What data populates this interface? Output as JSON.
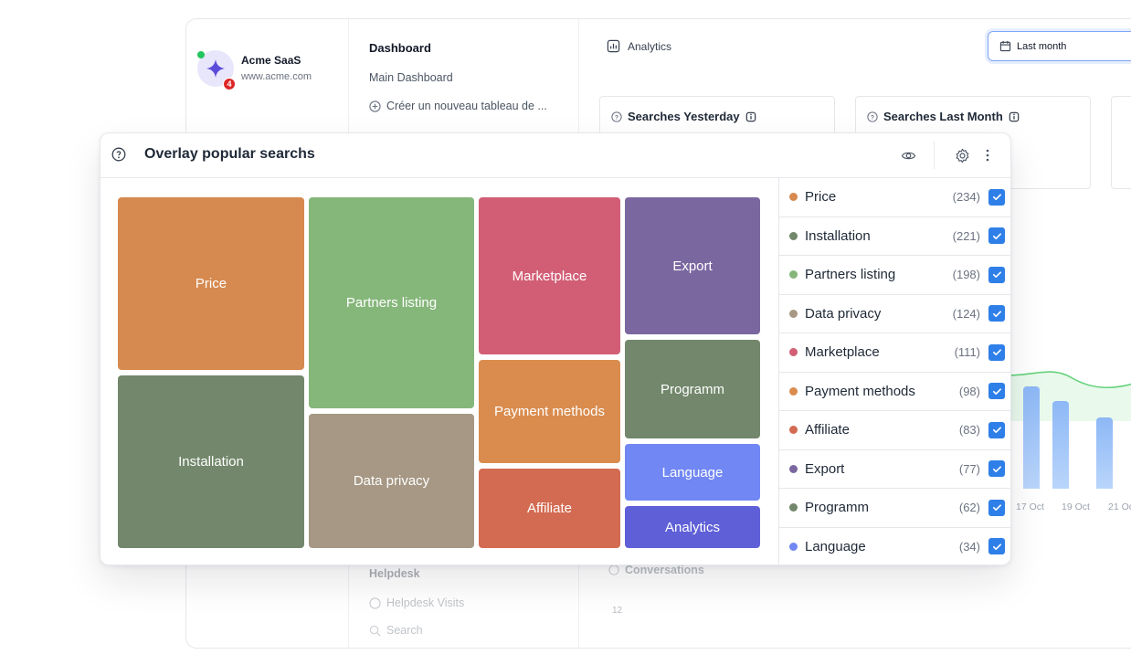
{
  "app": {
    "company_name": "Acme SaaS",
    "company_url": "www.acme.com",
    "notification_count": "4"
  },
  "nav": {
    "title": "Dashboard",
    "main_dashboard": "Main Dashboard",
    "create_dashboard": "Créer un nouveau tableau de ...",
    "helpdesk_section": "Helpdesk",
    "helpdesk_visits": "Helpdesk Visits",
    "search": "Search"
  },
  "main": {
    "analytics_tab": "Analytics",
    "date_range": "Last month",
    "cards": [
      {
        "title": "Searches Yesterday"
      },
      {
        "title": "Searches Last Month"
      }
    ],
    "conversations_label": "Conversations",
    "conversations_axis": "12",
    "x_labels": [
      "17 Oct",
      "19 Oct",
      "21 Oc"
    ]
  },
  "panel": {
    "title": "Overlay popular searchs",
    "icons": [
      "help-icon",
      "eye-icon",
      "gear-icon",
      "more-vertical-icon"
    ]
  },
  "tiles": [
    {
      "label": "Price",
      "color": "#d68a4f"
    },
    {
      "label": "Installation",
      "color": "#72876b"
    },
    {
      "label": "Partners listing",
      "color": "#85b67a"
    },
    {
      "label": "Data privacy",
      "color": "#a69884"
    },
    {
      "label": "Marketplace",
      "color": "#d25e76"
    },
    {
      "label": "Payment methods",
      "color": "#d98c4e"
    },
    {
      "label": "Affiliate",
      "color": "#d36b52"
    },
    {
      "label": "Export",
      "color": "#7b67a0"
    },
    {
      "label": "Programm",
      "color": "#72876b"
    },
    {
      "label": "Language",
      "color": "#7187f4"
    },
    {
      "label": "Analytics",
      "color": "#5f60d8"
    }
  ],
  "legend": [
    {
      "label": "Price",
      "count": "(234)",
      "color": "#d68a4f"
    },
    {
      "label": "Installation",
      "count": "(221)",
      "color": "#72876b"
    },
    {
      "label": "Partners listing",
      "count": "(198)",
      "color": "#85b67a"
    },
    {
      "label": "Data privacy",
      "count": "(124)",
      "color": "#a69884"
    },
    {
      "label": "Marketplace",
      "count": "(111)",
      "color": "#d25e76"
    },
    {
      "label": "Payment methods",
      "count": "(98)",
      "color": "#d98c4e"
    },
    {
      "label": "Affiliate",
      "count": "(83)",
      "color": "#d36b52"
    },
    {
      "label": "Export",
      "count": "(77)",
      "color": "#7b67a0"
    },
    {
      "label": "Programm",
      "count": "(62)",
      "color": "#72876b"
    },
    {
      "label": "Language",
      "count": "(34)",
      "color": "#7187f4"
    }
  ]
}
